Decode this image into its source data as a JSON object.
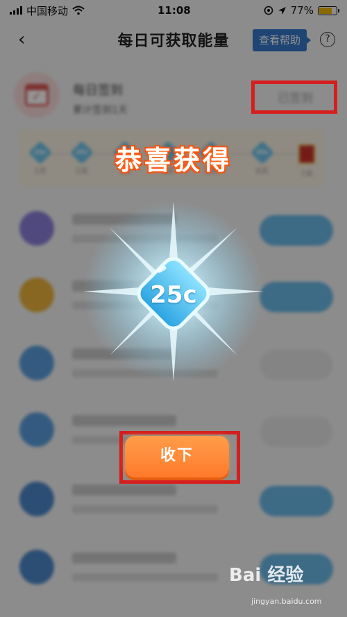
{
  "status_bar": {
    "carrier": "中国移动",
    "time": "11:08",
    "battery": "77%"
  },
  "header": {
    "title": "每日可获取能量",
    "help_label": "查看帮助",
    "help_icon": "?"
  },
  "checkin": {
    "title": "每日签到",
    "subtitle": "累计签到1天",
    "status_label": "已签到"
  },
  "week": {
    "days": [
      {
        "label": "1天",
        "reward": "25c"
      },
      {
        "label": "2天",
        "reward": "25c"
      },
      {
        "label": "3天",
        "reward": ""
      },
      {
        "label": "4天",
        "reward": ""
      },
      {
        "label": "5天",
        "reward": ""
      },
      {
        "label": "6天",
        "reward": "40c"
      },
      {
        "label": "7天",
        "reward": ""
      }
    ]
  },
  "tasks": [
    {
      "title": "分享获得能量",
      "subtitle": ""
    },
    {
      "title": "",
      "subtitle": ""
    },
    {
      "title": "",
      "subtitle": ""
    },
    {
      "title": "助力车",
      "subtitle": ""
    },
    {
      "title": "单次顺风车",
      "subtitle": ""
    },
    {
      "title": "",
      "subtitle": ""
    }
  ],
  "popup": {
    "congrats": "恭喜获得",
    "reward_amount": "25c",
    "collect_label": "收下"
  },
  "watermark": {
    "logo": "Bai 经验",
    "url": "jingyan.baidu.com"
  },
  "colors": {
    "accent_blue": "#3578c6",
    "highlight_red": "#d51e1e",
    "collect_orange": "#ff7a2a",
    "gem_blue": "#6fc3ea"
  },
  "icons": [
    "back-arrow-icon",
    "help-icon",
    "calendar-icon",
    "wifi-icon",
    "location-icon",
    "alarm-icon",
    "battery-icon"
  ]
}
